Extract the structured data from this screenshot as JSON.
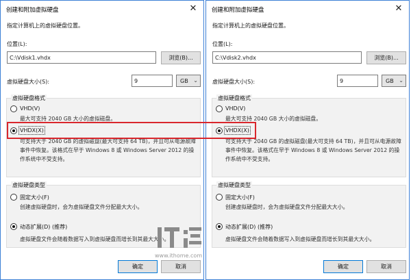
{
  "colors": {
    "highlight": "#d9262c",
    "accent_border": "#3c7fd6",
    "group_bg": "#f2f2f2"
  },
  "icons": {
    "close": "close-icon",
    "dropdown": "chevron-down-icon"
  },
  "dialogs": [
    {
      "title": "创建和附加虚拟硬盘",
      "instruction": "指定计算机上的虚拟硬盘位置。",
      "location_label": "位置(L):",
      "location_value": "C:\\Vdisk1.vhdx",
      "browse_label": "浏览(B)...",
      "size_label": "虚拟硬盘大小(S):",
      "size_value": "9",
      "size_unit": "GB",
      "format_group_title": "虚拟硬盘格式",
      "vhd_label": "VHD(V)",
      "vhd_desc": "最大可支持 2040 GB 大小的虚拟磁盘。",
      "vhdx_label": "VHDX(X)",
      "vhdx_desc": "可支持大于 2040 GB 的虚拟磁盘(最大可支持 64 TB)，并且可从电源故障事件中恢复。该格式在早于 Windows 8 或 Windows Server 2012 的操作系统中不受支持。",
      "type_group_title": "虚拟硬盘类型",
      "fixed_label": "固定大小(F)",
      "fixed_desc": "创建虚拟硬盘时，会为虚拟硬盘文件分配最大大小。",
      "dynamic_label": "动态扩展(D) (推荐)",
      "dynamic_desc": "虚拟硬盘文件会随着数据写入到虚拟硬盘而增长到其最大大小。",
      "ok_label": "确定",
      "cancel_label": "取消",
      "selected_format": "VHDX",
      "selected_type": "dynamic"
    },
    {
      "title": "创建和附加虚拟硬盘",
      "instruction": "指定计算机上的虚拟硬盘位置。",
      "location_label": "位置(L):",
      "location_value": "C:\\Vdisk2.vhdx",
      "browse_label": "浏览(B)...",
      "size_label": "虚拟硬盘大小(S):",
      "size_value": "9",
      "size_unit": "GB",
      "format_group_title": "虚拟硬盘格式",
      "vhd_label": "VHD(V)",
      "vhd_desc": "最大可支持 2040 GB 大小的虚拟磁盘。",
      "vhdx_label": "VHDX(X)",
      "vhdx_desc": "可支持大于 2040 GB 的虚拟磁盘(最大可支持 64 TB)，并且可从电源故障事件中恢复。该格式在早于 Windows 8 或 Windows Server 2012 的操作系统中不受支持。",
      "type_group_title": "虚拟硬盘类型",
      "fixed_label": "固定大小(F)",
      "fixed_desc": "创建虚拟硬盘时，会为虚拟硬盘文件分配最大大小。",
      "dynamic_label": "动态扩展(D) (推荐)",
      "dynamic_desc": "虚拟硬盘文件会随着数据写入到虚拟硬盘而增长到其最大大小。",
      "ok_label": "确定",
      "cancel_label": "取消",
      "selected_format": "VHDX",
      "selected_type": "dynamic"
    }
  ],
  "watermark": {
    "logo_text": "IT之家",
    "url": "www.ithome.com"
  }
}
